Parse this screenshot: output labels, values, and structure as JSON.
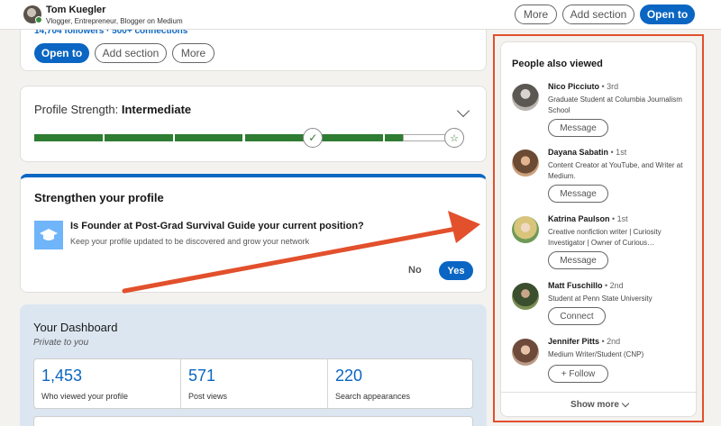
{
  "topbar": {
    "name": "Tom Kuegler",
    "headline": "Vlogger, Entrepreneur, Blogger on Medium",
    "more_label": "More",
    "add_section_label": "Add section",
    "open_to_label": "Open to"
  },
  "intro": {
    "stats": "14,704 followers  · 500+ connections",
    "open_to_label": "Open to",
    "add_section_label": "Add section",
    "more_label": "More"
  },
  "strength": {
    "label": "Profile Strength: ",
    "level": "Intermediate",
    "progress_fraction": 0.88
  },
  "suggestion": {
    "title": "Strengthen your profile",
    "question": "Is Founder at Post-Grad Survival Guide your current position?",
    "subtext": "Keep your profile updated to be discovered and grow your network",
    "no_label": "No",
    "yes_label": "Yes"
  },
  "dashboard": {
    "title": "Your Dashboard",
    "subtitle": "Private to you",
    "metrics": [
      {
        "value": "1,453",
        "label": "Who viewed your profile"
      },
      {
        "value": "571",
        "label": "Post views"
      },
      {
        "value": "220",
        "label": "Search appearances"
      }
    ]
  },
  "rail": {
    "title": "People also viewed",
    "people": [
      {
        "name": "Nico Picciuto",
        "degree": " • 3rd",
        "desc": "Graduate Student at Columbia Journalism School",
        "button": "Message"
      },
      {
        "name": "Dayana Sabatin",
        "degree": " • 1st",
        "desc": "Content Creator at YouTube, and Writer at Medium.",
        "button": "Message"
      },
      {
        "name": "Katrina Paulson",
        "degree": " • 1st",
        "desc": "Creative nonfiction writer | Curiosity Investigator | Owner of Curious…",
        "button": "Message"
      },
      {
        "name": "Matt Fuschillo",
        "degree": " • 2nd",
        "desc": "Student at Penn State University",
        "button": "Connect"
      },
      {
        "name": "Jennifer Pitts",
        "degree": " • 2nd",
        "desc": "Medium Writer/Student (CNP)",
        "button": "+ Follow"
      }
    ],
    "show_more_label": "Show more"
  },
  "colors": {
    "accent": "#0a66c2",
    "progress": "#2e7d32",
    "annotation": "#e2502c",
    "dashboard_bg": "#dce6f1"
  }
}
